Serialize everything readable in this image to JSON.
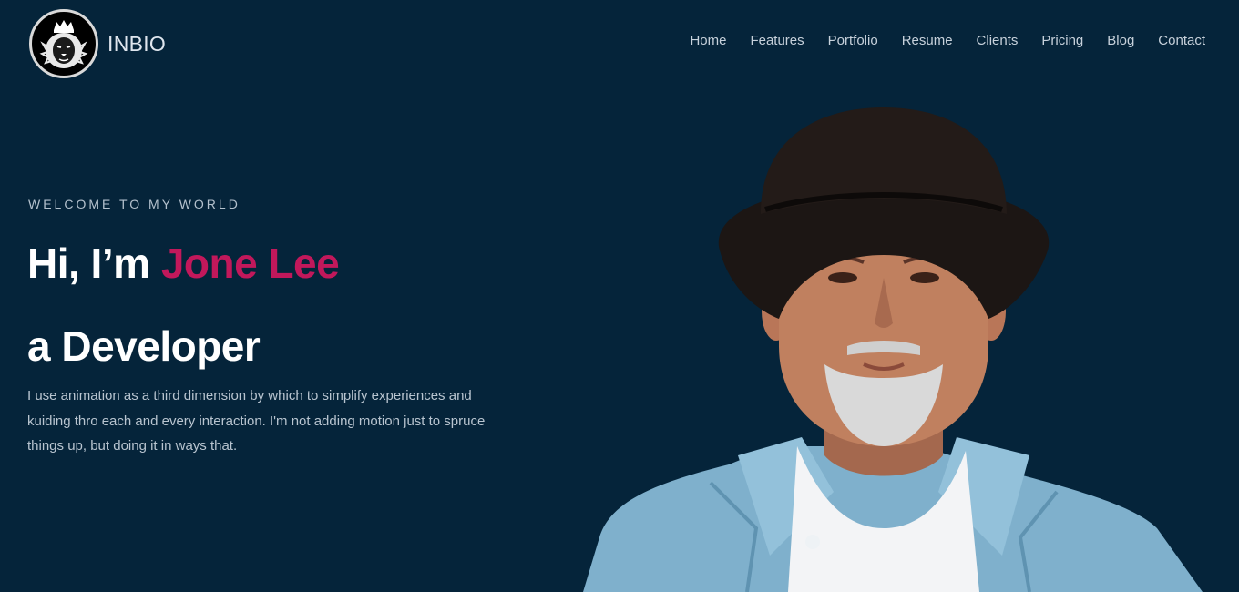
{
  "header": {
    "brand": "INBIO",
    "logo_icon": "lion-crest-icon",
    "nav": [
      "Home",
      "Features",
      "Portfolio",
      "Resume",
      "Clients",
      "Pricing",
      "Blog",
      "Contact"
    ]
  },
  "hero": {
    "eyebrow": "WELCOME TO MY WORLD",
    "greeting": "Hi, I’m ",
    "name": "Jone Lee",
    "role": "a Developer",
    "description": "I use animation as a third dimension by which to simplify experiences and kuiding thro each and every interaction. I'm not adding motion just to spruce things up, but doing it in ways that."
  },
  "colors": {
    "background": "#05243a",
    "accent": "#c2185b",
    "text": "#ffffff",
    "muted": "#b9c5d0"
  }
}
